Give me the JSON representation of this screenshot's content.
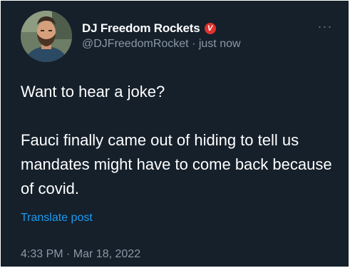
{
  "tweet": {
    "author": {
      "display_name": "DJ Freedom Rockets",
      "badge_letter": "V",
      "handle": "@DJFreedomRocket",
      "separator": " · ",
      "relative_time": "just now",
      "avatar_icon": "profile-photo"
    },
    "text": "Want to hear a joke?\n\nFauci finally came out of hiding to tell us mandates might have to come back because of covid.",
    "translate_label": "Translate post",
    "timestamp": "4:33 PM · Mar 18, 2022",
    "more_icon": "more-horizontal-icon"
  },
  "colors": {
    "background": "#15202b",
    "text_primary": "#ffffff",
    "text_secondary": "#8b98a5",
    "link": "#1d9bf0",
    "badge": "#e0312f"
  }
}
